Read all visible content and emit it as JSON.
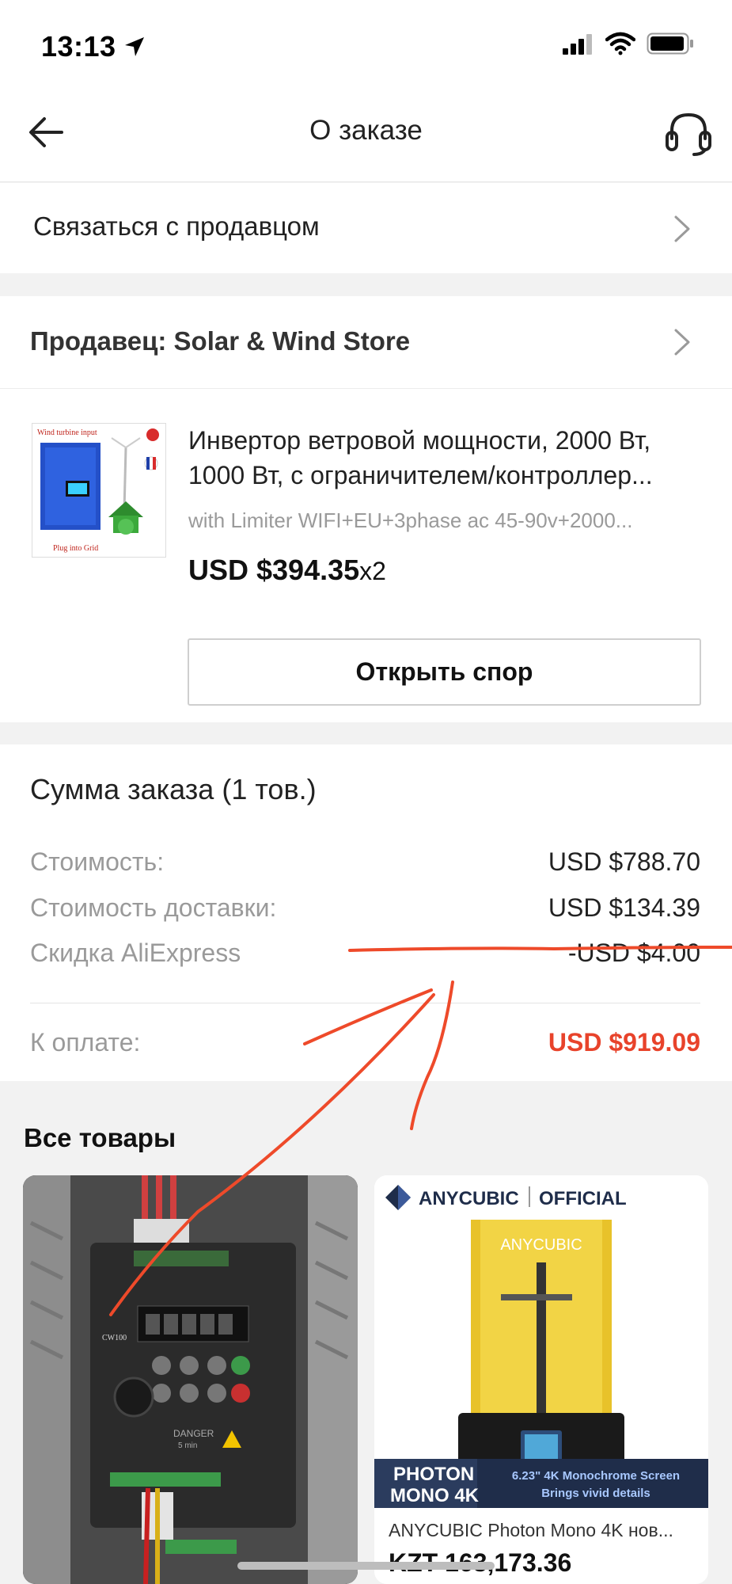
{
  "status_bar": {
    "time": "13:13"
  },
  "nav": {
    "title": "О заказе"
  },
  "contact": {
    "label": "Связаться с продавцом"
  },
  "seller": {
    "label": "Продавец: Solar & Wind Store"
  },
  "product": {
    "title": "Инвертор ветровой мощности, 2000 Вт, 1000 Вт, с ограничителем/контроллер...",
    "variant": "with Limiter WIFI+EU+3phase ac 45-90v+2000...",
    "price": "USD $394.35",
    "qty": "x2",
    "thumb_texts": {
      "top": "Wind turbine input",
      "bottom": "Plug into Grid"
    }
  },
  "dispute_button": {
    "label": "Открыть спор"
  },
  "summary": {
    "title": "Сумма заказа (1 тов.)",
    "rows": [
      {
        "label": "Стоимость:",
        "value": "USD $788.70"
      },
      {
        "label": "Стоимость доставки:",
        "value": "USD $134.39"
      },
      {
        "label": "Скидка AliExpress",
        "value": "-USD $4.00"
      }
    ],
    "total": {
      "label": "К оплате:",
      "value": "USD $919.09"
    }
  },
  "all_products": {
    "title": "Все товары",
    "left_card": {
      "model": "CW100",
      "warning": "DANGER",
      "warning_sub": "5 min"
    },
    "right_card": {
      "brand": "ANYCUBIC",
      "official": "OFFICIAL",
      "printer_brand": "ANYCUBIC",
      "badge_line1": "PHOTON",
      "badge_line2": "MONO 4K",
      "feature_line1": "6.23\" 4K Monochrome Screen",
      "feature_line2": "Brings vivid details",
      "name": "ANYCUBIC Photon Mono 4K нов...",
      "price": "KZT 163,173.36"
    }
  },
  "colors": {
    "accent_red": "#e8432b",
    "annotation": "#ee4a2a"
  }
}
